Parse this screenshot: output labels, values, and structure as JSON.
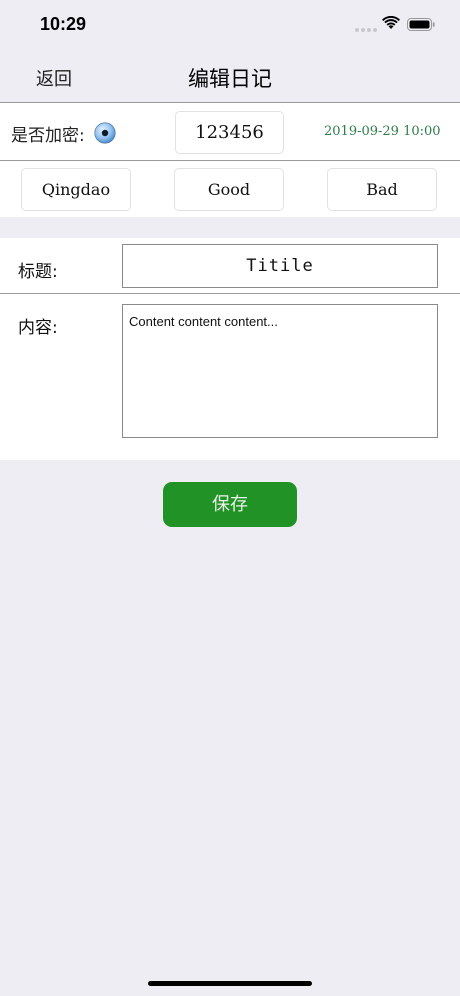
{
  "status_bar": {
    "time": "10:29"
  },
  "nav": {
    "back_label": "返回",
    "title": "编辑日记"
  },
  "entry": {
    "encrypt_label": "是否加密:",
    "password": "123456",
    "date": "2019-09-29 10:00",
    "tags": [
      "Qingdao",
      "Good",
      "Bad"
    ]
  },
  "form": {
    "title_label": "标题:",
    "title_value": "Titile",
    "content_label": "内容:",
    "content_value": "Content content content..."
  },
  "actions": {
    "save_label": "保存"
  },
  "colors": {
    "save_green": "#219226",
    "date_green": "#2e7d4a",
    "background": "#efedf4"
  }
}
